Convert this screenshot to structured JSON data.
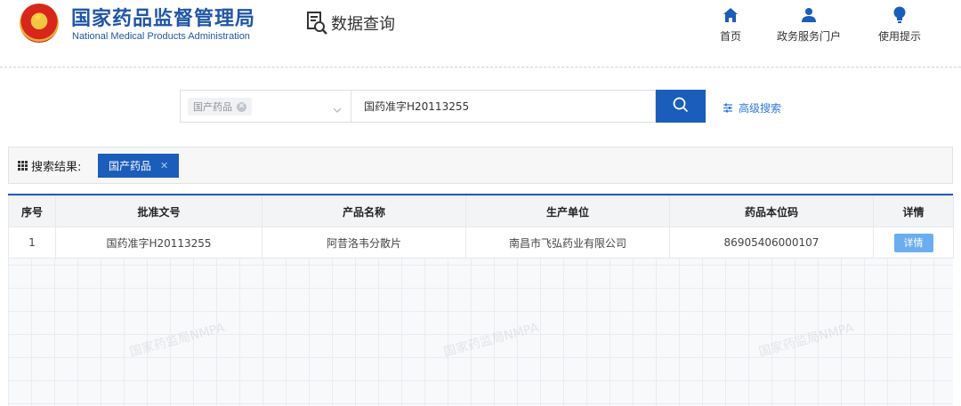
{
  "header": {
    "org_cn": "国家药品监督管理局",
    "org_en": "National Medical Products Administration",
    "section_title": "数据查询",
    "nav": [
      {
        "label": "首页",
        "icon": "home-icon"
      },
      {
        "label": "政务服务门户",
        "icon": "user-icon"
      },
      {
        "label": "使用提示",
        "icon": "lightbulb-icon"
      }
    ]
  },
  "search": {
    "category_tag": "国产药品",
    "query": "国药准字H20113255",
    "advanced_label": "高级搜索"
  },
  "results": {
    "label": "搜索结果:",
    "active_filter": "国产药品"
  },
  "table": {
    "headers": [
      "序号",
      "批准文号",
      "产品名称",
      "生产单位",
      "药品本位码",
      "详情"
    ],
    "rows": [
      {
        "index": "1",
        "approval_no": "国药准字H20113255",
        "product": "阿昔洛韦分散片",
        "manufacturer": "南昌市飞弘药业有限公司",
        "code": "86905406000107",
        "detail": "详情"
      }
    ]
  },
  "watermark": "国家药监局NMPA",
  "colors": {
    "primary": "#1a5dba",
    "brand_text": "#1f56a8",
    "detail_button": "#6aaef0"
  }
}
